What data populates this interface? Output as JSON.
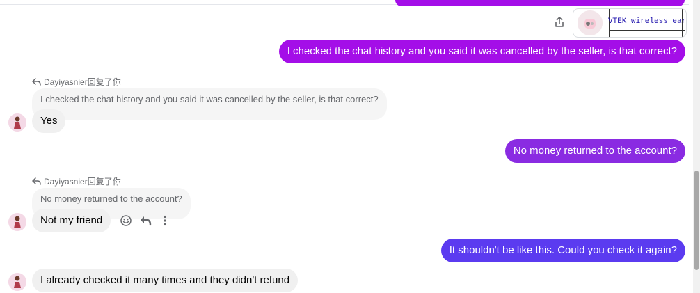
{
  "product_card": {
    "title": "VTEK wireless ear..."
  },
  "messages": {
    "out_1": "I checked the chat history and you said it was cancelled by the seller, is that correct?",
    "reply_1": {
      "label": "Dayiyasnier回复了你",
      "quoted": "I checked the chat history and you said it was cancelled by the seller, is that correct?",
      "text": "Yes"
    },
    "out_2": "No money returned to the account?",
    "reply_2": {
      "label": "Dayiyasnier回复了你",
      "quoted": "No money returned to the account?",
      "text": "Not my friend"
    },
    "out_3": "It shouldn't be like this. Could you check it again?",
    "in_3": "I already checked it many times and they didn't refund"
  },
  "icons": [
    "share-icon",
    "reply-arrow-icon",
    "emoji-icon",
    "reply-icon",
    "more-options-icon"
  ],
  "colors": {
    "bubble_purple": "#a40ee8",
    "bubble_violet": "#8a2be2",
    "bubble_indigo": "#5b3bf0",
    "bubble_gray": "#f0f0f0",
    "quoted_gray": "#f5f5f5",
    "meta_text": "#65676b"
  }
}
